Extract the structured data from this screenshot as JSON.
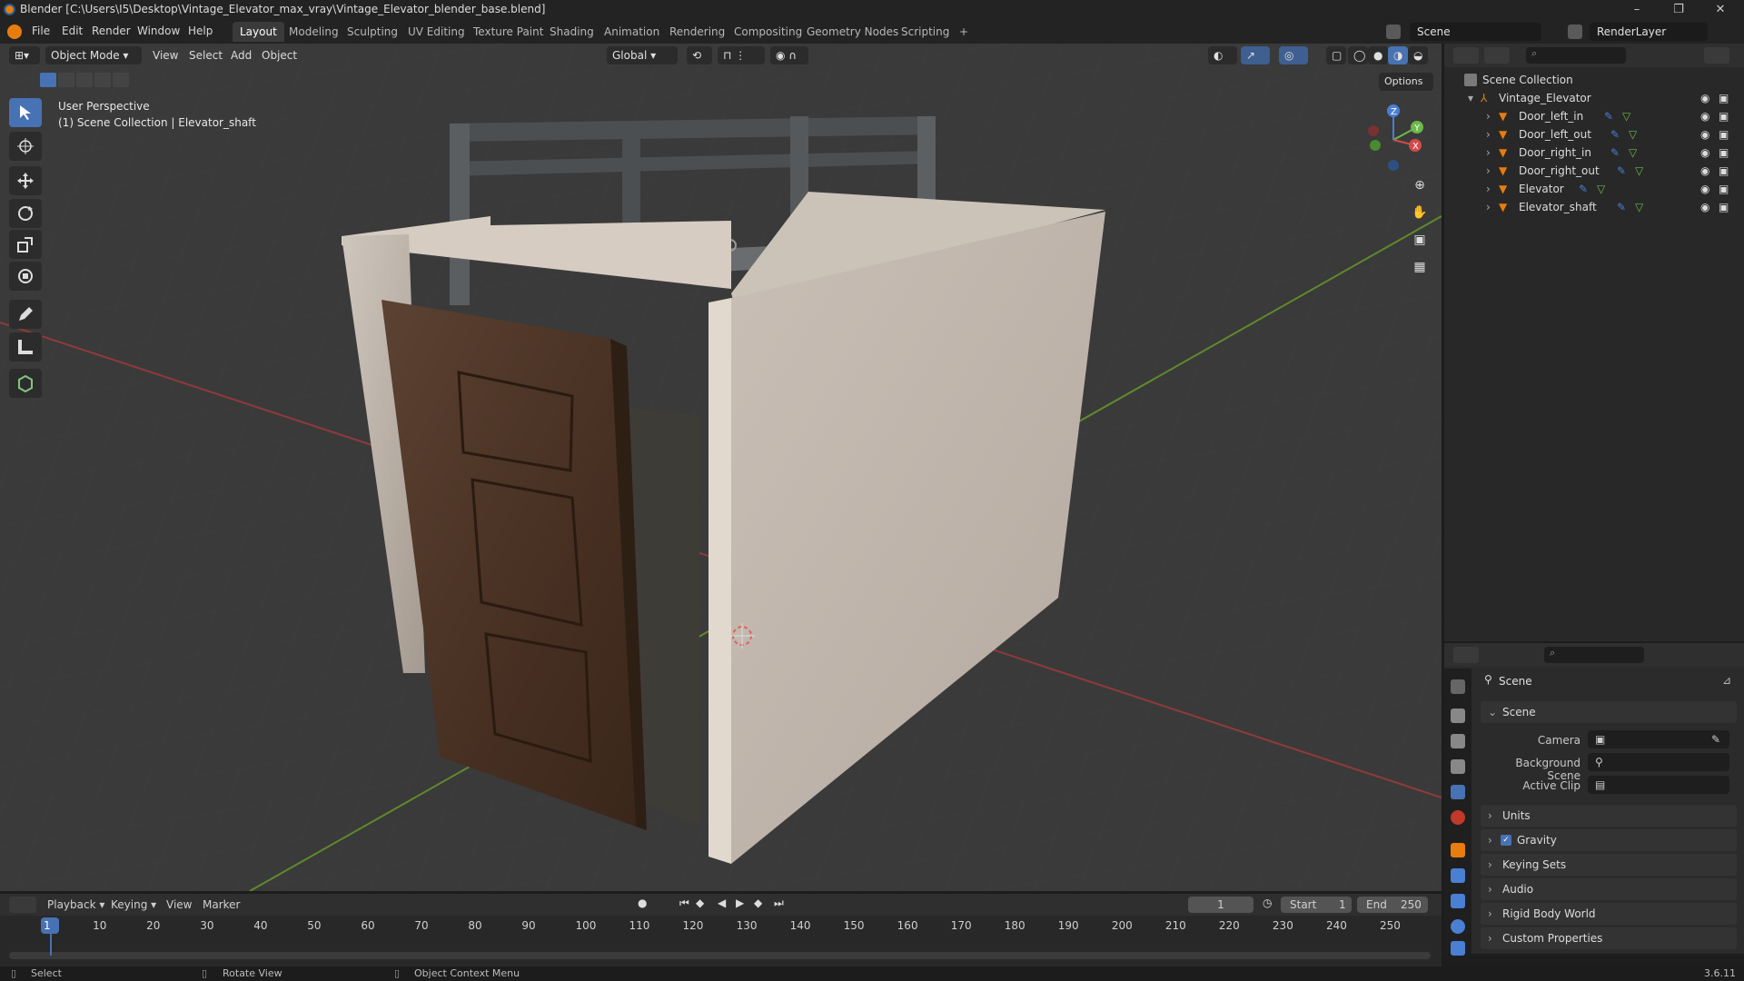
{
  "window": {
    "title": "Blender [C:\\Users\\I5\\Desktop\\Vintage_Elevator_max_vray\\Vintage_Elevator_blender_base.blend]"
  },
  "menu": {
    "items": [
      "File",
      "Edit",
      "Render",
      "Window",
      "Help"
    ]
  },
  "workspaces": {
    "tabs": [
      "Layout",
      "Modeling",
      "Sculpting",
      "UV Editing",
      "Texture Paint",
      "Shading",
      "Animation",
      "Rendering",
      "Compositing",
      "Geometry Nodes",
      "Scripting"
    ],
    "add": "+"
  },
  "scene_selector": {
    "value": "Scene"
  },
  "renderlayer_selector": {
    "value": "RenderLayer"
  },
  "viewport_header": {
    "mode": "Object Mode",
    "menus": [
      "View",
      "Select",
      "Add",
      "Object"
    ],
    "transform_orientation": "Global",
    "options": "Options"
  },
  "viewport_overlay": {
    "perspective": "User Perspective",
    "collection": "(1) Scene Collection | Elevator_shaft"
  },
  "gizmo": {
    "z": "Z",
    "y": "Y",
    "x": "X"
  },
  "outliner": {
    "root": "Scene Collection",
    "collection": "Vintage_Elevator",
    "objects": [
      "Door_left_in",
      "Door_left_out",
      "Door_right_in",
      "Door_right_out",
      "Elevator",
      "Elevator_shaft"
    ]
  },
  "properties": {
    "context": "Scene",
    "panel": "Scene",
    "camera_label": "Camera",
    "background_scene_label": "Background Scene",
    "active_clip_label": "Active Clip",
    "subpanels": [
      "Units",
      "Gravity",
      "Keying Sets",
      "Audio",
      "Rigid Body World",
      "Custom Properties"
    ],
    "gravity_checked": true
  },
  "timeline": {
    "menus": [
      "Playback",
      "Keying",
      "View",
      "Marker"
    ],
    "current_frame": "1",
    "start_label": "Start",
    "start": "1",
    "end_label": "End",
    "end": "250",
    "ticks": [
      "1",
      "10",
      "20",
      "30",
      "40",
      "50",
      "60",
      "70",
      "80",
      "90",
      "100",
      "110",
      "120",
      "130",
      "140",
      "150",
      "160",
      "170",
      "180",
      "190",
      "200",
      "210",
      "220",
      "230",
      "240",
      "250"
    ]
  },
  "statusbar": {
    "select": "Select",
    "rotate": "Rotate View",
    "context_menu": "Object Context Menu",
    "version": "3.6.11"
  },
  "colors": {
    "accent": "#4772b3",
    "orange": "#e87d0d",
    "green": "#6cb94a",
    "red_axis": "#a33a3a",
    "green_axis": "#5e8a2a"
  }
}
